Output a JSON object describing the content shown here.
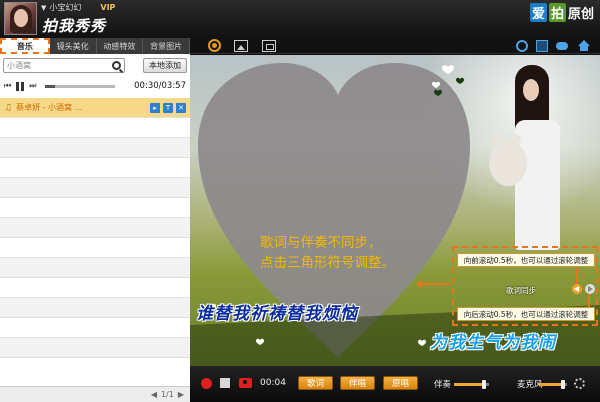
{
  "header": {
    "username": "小宝幻幻",
    "vip": "VIP",
    "app_name": "拍我秀秀",
    "watermark": {
      "part1": "爱",
      "part2": "拍",
      "part3": "原创"
    }
  },
  "left_panel": {
    "tabs": [
      {
        "label": "音乐",
        "active": true
      },
      {
        "label": "镜头美化",
        "active": false
      },
      {
        "label": "动感特效",
        "active": false
      },
      {
        "label": "背景图片",
        "active": false
      }
    ],
    "search": {
      "value": "小酒窝",
      "placeholder": "小酒窝"
    },
    "local_add_label": "本地添加",
    "player": {
      "time": "00:30/03:57",
      "progress": 0.13
    },
    "songs": [
      {
        "title": "蔡卓妍 - 小酒窝 ...",
        "active": true
      }
    ],
    "pagination": "1/1"
  },
  "video": {
    "annotation_line1": "歌词与伴奏不同步，",
    "annotation_line2": "点击三角形符号调整。",
    "lyric_line1": "谁替我祈祷替我烦恼",
    "lyric_line2": "为我生气为我闹",
    "sync": {
      "tip_forward": "向前滚动0.5秒，也可以通过滚轮调整",
      "label": "歌词同步",
      "tip_backward": "向后滚动0.5秒，也可以通过滚轮调整"
    }
  },
  "bottom_bar": {
    "rec_time": "00:04",
    "btn_lyrics": "歌词",
    "btn_accompany": "伴唱",
    "btn_vocal": "原唱",
    "acc_label": "伴奏",
    "mic_label": "麦克风",
    "acc_volume": 0.85,
    "mic_volume": 0.85
  },
  "colors": {
    "accent_orange": "#e8741c",
    "lyric_blue": "#0b2d9b",
    "lyric_cyan": "#1aa0e8",
    "annotation_yellow": "#f3b800"
  }
}
